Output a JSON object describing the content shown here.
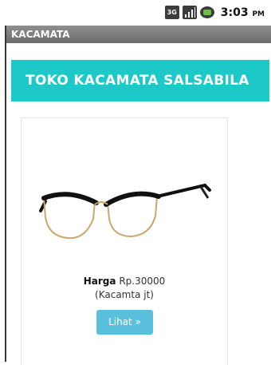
{
  "status_bar": {
    "network_label": "3G",
    "time": "3:03",
    "ampm": "PM",
    "icons": [
      "network-3g-icon",
      "signal-icon",
      "battery-icon"
    ]
  },
  "app_bar": {
    "title": "KACAMATA"
  },
  "banner": {
    "title": "TOKO KACAMATA SALSABILA",
    "color": "#1dc8c8"
  },
  "product": {
    "image": "glasses-image",
    "price_label": "Harga",
    "price_value": "Rp.30000",
    "name": "(Kacamta jt)",
    "button_label": "Lihat »",
    "button_color": "#5bc0de"
  }
}
